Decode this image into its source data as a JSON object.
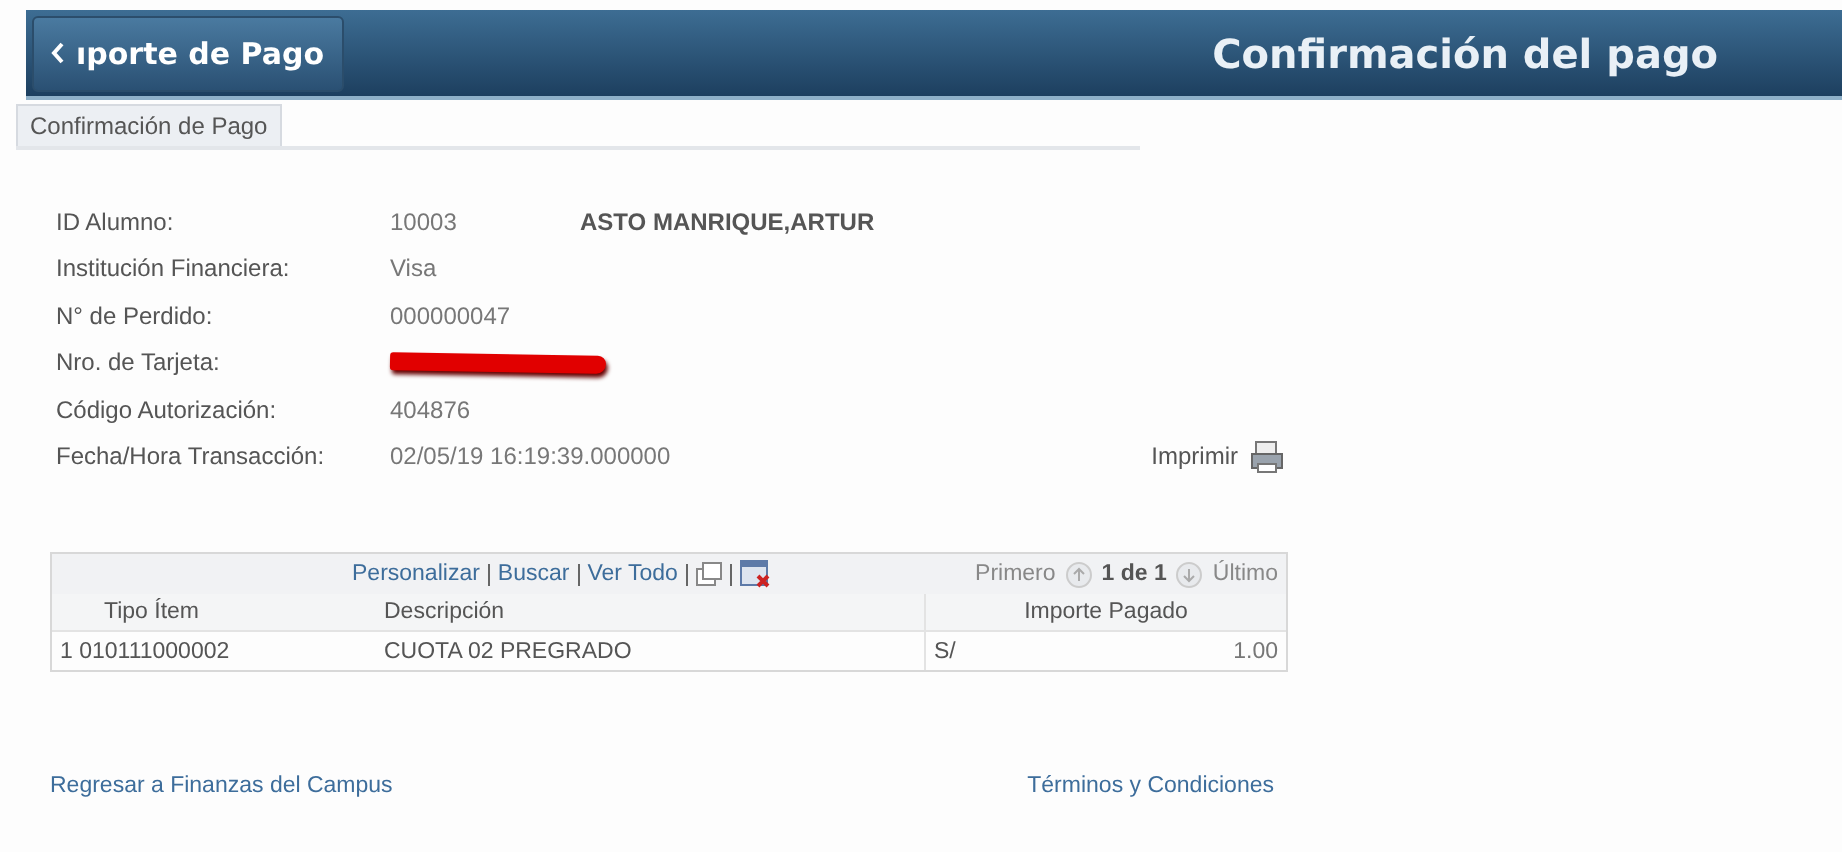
{
  "header": {
    "back_button": "ıporte de Pago",
    "title": "Confirmación del pago"
  },
  "tabs": [
    {
      "label": "Confirmación de Pago",
      "selected": true
    }
  ],
  "fields": [
    {
      "kind": "text",
      "label": "ID Alumno:",
      "value": "10003",
      "extra": "ASTO MANRIQUE,ARTUR"
    },
    {
      "kind": "text",
      "label": "Institución Financiera:",
      "value": "Visa"
    },
    {
      "kind": "text",
      "label": "N° de Perdido:",
      "value": "000000047"
    },
    {
      "kind": "redacted",
      "label": "Nro. de Tarjeta:"
    },
    {
      "kind": "text",
      "label": "Código Autorización:",
      "value": "404876"
    },
    {
      "kind": "text",
      "label": "Fecha/Hora Transacción:",
      "value": "02/05/19 16:19:39.000000"
    }
  ],
  "print_link": "Imprimir",
  "grid": {
    "toolbar_links": [
      "Personalizar",
      "Buscar",
      "Ver Todo"
    ],
    "pager": {
      "first": "Primero",
      "range": "1 de 1",
      "last": "Último"
    },
    "columns": [
      "Tipo Ítem",
      "Descripción",
      "Importe Pagado"
    ],
    "rows": [
      {
        "number": "1",
        "type": "010111000002",
        "description": "CUOTA 02 PREGRADO",
        "currency": "S/",
        "amount": "1.00"
      }
    ]
  },
  "footer": {
    "left_link": "Regresar a Finanzas del Campus",
    "right_link": "Términos y Condiciones"
  }
}
